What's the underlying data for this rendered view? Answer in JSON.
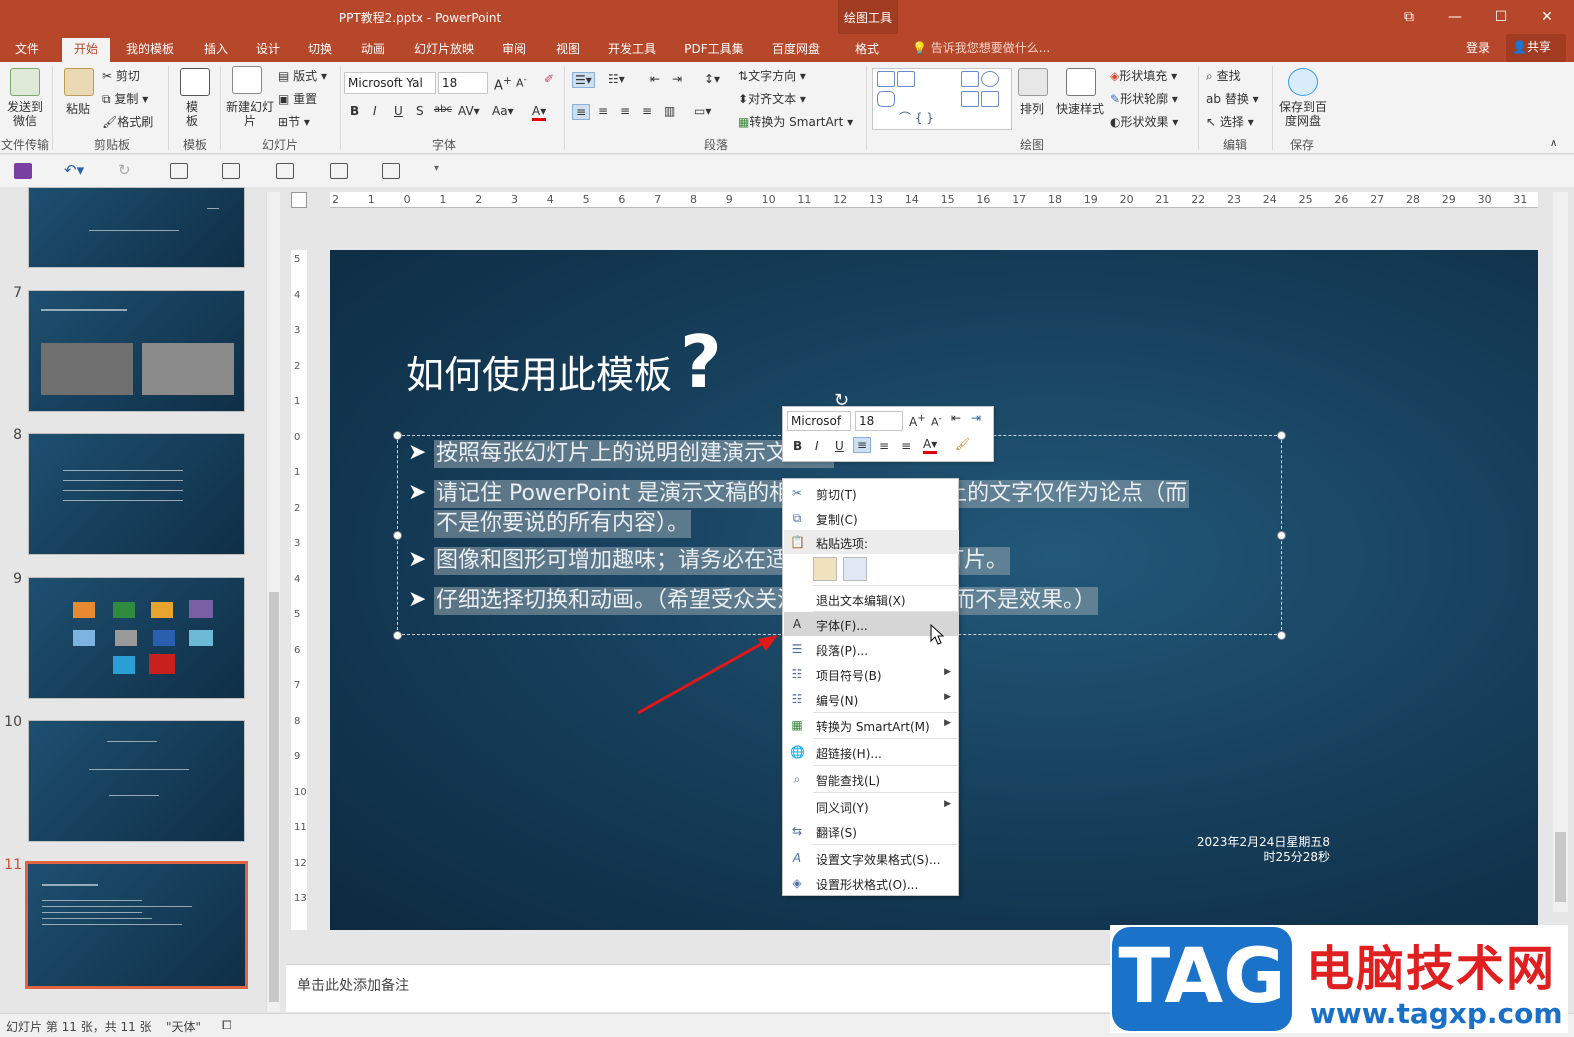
{
  "window": {
    "title": "PPT教程2.pptx - PowerPoint",
    "contextual_group": "绘图工具",
    "controls": [
      "⧉",
      "—",
      "☐",
      "✕"
    ]
  },
  "tabs": [
    {
      "label": "文件",
      "active": false
    },
    {
      "label": "开始",
      "active": true
    },
    {
      "label": "我的模板",
      "active": false
    },
    {
      "label": "插入",
      "active": false
    },
    {
      "label": "设计",
      "active": false
    },
    {
      "label": "切换",
      "active": false
    },
    {
      "label": "动画",
      "active": false
    },
    {
      "label": "幻灯片放映",
      "active": false
    },
    {
      "label": "审阅",
      "active": false
    },
    {
      "label": "视图",
      "active": false
    },
    {
      "label": "开发工具",
      "active": false
    },
    {
      "label": "PDF工具集",
      "active": false
    },
    {
      "label": "百度网盘",
      "active": false
    },
    {
      "label": "格式",
      "active": false
    }
  ],
  "tell_me": "告诉我您想要做什么...",
  "login": "登录",
  "share": "共享",
  "ribbon": {
    "send_wechat": "发送到微信",
    "paste": "粘贴",
    "cut": "剪切",
    "copy": "复制",
    "format_painter": "格式刷",
    "template": "模板",
    "new_slide": "新建幻灯片",
    "layout": "版式",
    "reset": "重置",
    "section": "节",
    "font_name": "Microsoft Yal",
    "font_size": "18",
    "text_direction": "文字方向",
    "align_text": "对齐文本",
    "convert_smartart": "转换为 SmartArt",
    "arrange": "排列",
    "quick_styles": "快速样式",
    "shape_fill": "形状填充",
    "shape_outline": "形状轮廓",
    "shape_effects": "形状效果",
    "find": "查找",
    "replace": "替换",
    "select": "选择",
    "save_baidu": "保存到百度网盘",
    "groups": {
      "file_transfer": "文件传输",
      "clipboard": "剪贴板",
      "template": "模板",
      "slides": "幻灯片",
      "font": "字体",
      "paragraph": "段落",
      "drawing": "绘图",
      "editing": "编辑",
      "save": "保存"
    }
  },
  "ruler": {
    "h_marks": [
      "2",
      "1",
      "0",
      "1",
      "2",
      "3",
      "4",
      "5",
      "6",
      "7",
      "8",
      "9",
      "10",
      "11",
      "12",
      "13",
      "14",
      "15",
      "16",
      "17",
      "18",
      "19",
      "20",
      "21",
      "22",
      "23",
      "24",
      "25",
      "26",
      "27",
      "28",
      "29",
      "30",
      "31"
    ],
    "v_marks": [
      "5",
      "4",
      "3",
      "2",
      "1",
      "0",
      "1",
      "2",
      "3",
      "4",
      "5",
      "6",
      "7",
      "8",
      "9",
      "10",
      "11",
      "12",
      "13"
    ]
  },
  "thumbnails": [
    {
      "num": "",
      "label": "slide-6-partial"
    },
    {
      "num": "7",
      "label": "slide-7"
    },
    {
      "num": "8",
      "label": "slide-8"
    },
    {
      "num": "9",
      "label": "slide-9"
    },
    {
      "num": "10",
      "label": "slide-10"
    },
    {
      "num": "11",
      "label": "slide-11"
    }
  ],
  "slide": {
    "title": "如何使用此模板",
    "title_mark": "?",
    "bullets": [
      "按照每张幻灯片上的说明创建演示文稿。",
      "请记住 PowerPoint 是演示文稿的相应部分。幻灯片上的文字仅作为论点（而",
      "不是你要说的所有内容）。",
      "图像和图形可增加趣味；请务必在适当的地方使用幻灯片。",
      "仔细选择切换和动画。（希望受众关注的是你的内容，而不是效果。）"
    ],
    "date_line1": "2023年2月24日星期五8",
    "date_line2": "时25分28秒"
  },
  "mini_toolbar": {
    "font_name": "Microsof",
    "font_size": "18"
  },
  "context_menu": {
    "cut": "剪切(T)",
    "copy": "复制(C)",
    "paste_options": "粘贴选项:",
    "exit_edit": "退出文本编辑(X)",
    "font": "字体(F)...",
    "paragraph": "段落(P)...",
    "bullets": "项目符号(B)",
    "numbering": "编号(N)",
    "convert_smartart": "转换为 SmartArt(M)",
    "hyperlink": "超链接(H)...",
    "smart_lookup": "智能查找(L)",
    "synonyms": "同义词(Y)",
    "translate": "翻译(S)",
    "text_effects": "设置文字效果格式(S)...",
    "shape_format": "设置形状格式(O)..."
  },
  "notes_placeholder": "单击此处添加备注",
  "status": {
    "slide_info": "幻灯片 第 11 张，共 11 张",
    "theme": "\"天体\""
  },
  "watermark": {
    "tag": "TAG",
    "cn": "电脑技术网",
    "url": "www.tagxp.com"
  },
  "colors": {
    "accent": "#b7472a",
    "slide_bg": "#153c58",
    "selection_thumb": "#e0643f"
  }
}
